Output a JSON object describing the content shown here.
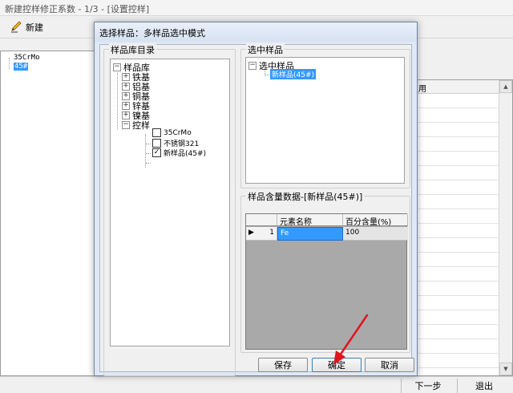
{
  "window": {
    "title": "新建控样修正系数 - 1/3 - [设置控样]"
  },
  "toolbar": {
    "new_label": "新建"
  },
  "main": {
    "tree_items": [
      "35CrMo",
      "45#"
    ],
    "column_header": "用",
    "next_label": "下一步",
    "exit_label": "退出"
  },
  "dialog": {
    "title": "选择样品：多样品选中模式",
    "library": {
      "legend": "样品库目录",
      "root": "样品库",
      "categories": [
        "铁基",
        "铝基",
        "铜基",
        "锌基",
        "镍基",
        "控样"
      ],
      "samples": [
        {
          "label": "35CrMo",
          "checked": false
        },
        {
          "label": "不锈钢321",
          "checked": false
        },
        {
          "label": "新样品(45#)",
          "checked": true
        }
      ]
    },
    "selected": {
      "legend": "选中样品",
      "root": "选中样品",
      "item": "新样品(45#)"
    },
    "content": {
      "legend": "样品含量数据-[新样品(45#)]",
      "columns": [
        "元素名称",
        "百分含量(%)"
      ],
      "rows": [
        {
          "index": "1",
          "element": "Fe",
          "percent": "100"
        }
      ]
    },
    "buttons": {
      "save": "保存",
      "ok": "确定",
      "cancel": "取消"
    }
  },
  "colors": {
    "selection": "#3399ff",
    "arrow": "#e0141e",
    "grid_background": "#a9a9a9"
  }
}
